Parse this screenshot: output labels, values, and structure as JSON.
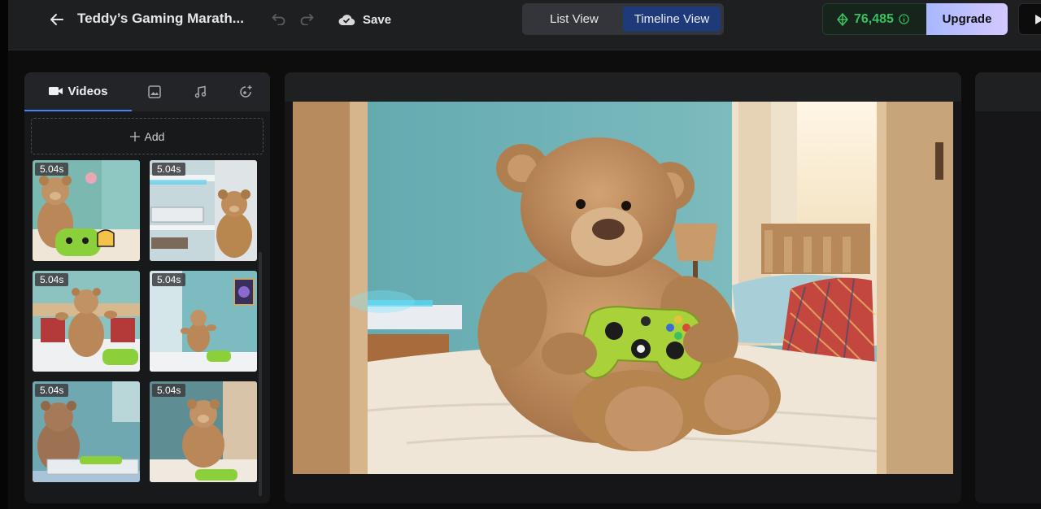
{
  "header": {
    "title": "Teddy’s Gaming Marath...",
    "save_label": "Save",
    "view_tabs": [
      {
        "label": "List View",
        "active": false
      },
      {
        "label": "Timeline View",
        "active": true
      }
    ],
    "credits": "76,485",
    "upgrade_label": "Upgrade"
  },
  "media_panel": {
    "tabs": [
      {
        "label": "Videos",
        "icon": "video-camera-icon",
        "active": true
      },
      {
        "icon": "image-icon"
      },
      {
        "icon": "music-note-icon"
      },
      {
        "icon": "sound-effects-icon"
      }
    ],
    "add_label": "Add",
    "clips": [
      {
        "duration": "5.04s"
      },
      {
        "duration": "5.04s"
      },
      {
        "duration": "5.04s"
      },
      {
        "duration": "5.04s"
      },
      {
        "duration": "5.04s"
      },
      {
        "duration": "5.04s"
      }
    ]
  },
  "colors": {
    "accent": "#4a7dff",
    "active_tab_bg": "#1f3a78",
    "credits_green": "#37c25f",
    "controller_green": "#a9d13a"
  }
}
